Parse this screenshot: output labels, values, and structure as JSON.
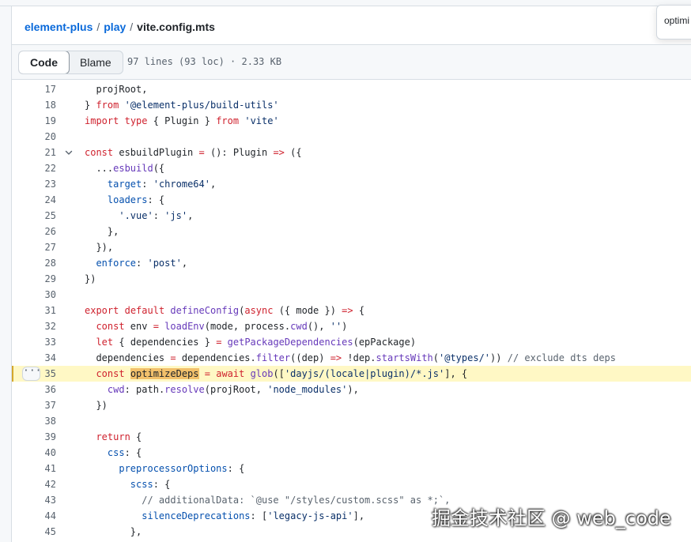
{
  "breadcrumb": {
    "repo": "element-plus",
    "folder": "play",
    "separator": "/",
    "file": "vite.config.mts"
  },
  "popup": {
    "text": "optimi"
  },
  "toolbar": {
    "code_label": "Code",
    "blame_label": "Blame",
    "file_info": "97 lines (93 loc) · 2.33 KB",
    "active_tab": "Code"
  },
  "code": {
    "highlighted_line": 35,
    "lines": [
      {
        "n": "17",
        "text": "  projRoot,"
      },
      {
        "n": "18",
        "text": "} from '@element-plus/build-utils'"
      },
      {
        "n": "19",
        "text": "import type { Plugin } from 'vite'"
      },
      {
        "n": "20",
        "text": ""
      },
      {
        "n": "21",
        "text": "const esbuildPlugin = (): Plugin => ({",
        "fold": true
      },
      {
        "n": "22",
        "text": "  ...esbuild({"
      },
      {
        "n": "23",
        "text": "    target: 'chrome64',"
      },
      {
        "n": "24",
        "text": "    loaders: {"
      },
      {
        "n": "25",
        "text": "      '.vue': 'js',"
      },
      {
        "n": "26",
        "text": "    },"
      },
      {
        "n": "27",
        "text": "  }),"
      },
      {
        "n": "28",
        "text": "  enforce: 'post',"
      },
      {
        "n": "29",
        "text": "})"
      },
      {
        "n": "30",
        "text": ""
      },
      {
        "n": "31",
        "text": "export default defineConfig(async ({ mode }) => {"
      },
      {
        "n": "32",
        "text": "  const env = loadEnv(mode, process.cwd(), '')"
      },
      {
        "n": "33",
        "text": "  let { dependencies } = getPackageDependencies(epPackage)"
      },
      {
        "n": "34",
        "text": "  dependencies = dependencies.filter((dep) => !dep.startsWith('@types/')) // exclude dts deps"
      },
      {
        "n": "35",
        "text": "  const optimizeDeps = await glob(['dayjs/(locale|plugin)/*.js'], {"
      },
      {
        "n": "36",
        "text": "    cwd: path.resolve(projRoot, 'node_modules'),"
      },
      {
        "n": "37",
        "text": "  })"
      },
      {
        "n": "38",
        "text": ""
      },
      {
        "n": "39",
        "text": "  return {"
      },
      {
        "n": "40",
        "text": "    css: {"
      },
      {
        "n": "41",
        "text": "      preprocessorOptions: {"
      },
      {
        "n": "42",
        "text": "        scss: {"
      },
      {
        "n": "43",
        "text": "          // additionalData: `@use \"/styles/custom.scss\" as *;`,"
      },
      {
        "n": "44",
        "text": "          silenceDeprecations: ['legacy-js-api'],"
      },
      {
        "n": "45",
        "text": "        },"
      }
    ]
  },
  "watermark": {
    "text": "掘金技术社区 @ web_code"
  },
  "colors": {
    "keyword": "#cf222e",
    "string": "#0a3069",
    "function": "#6639ba",
    "property": "#0550ae",
    "comment": "#59636e",
    "link": "#0969da",
    "highlight_line": "#fff8c5",
    "search_match": "#f2c06b"
  }
}
